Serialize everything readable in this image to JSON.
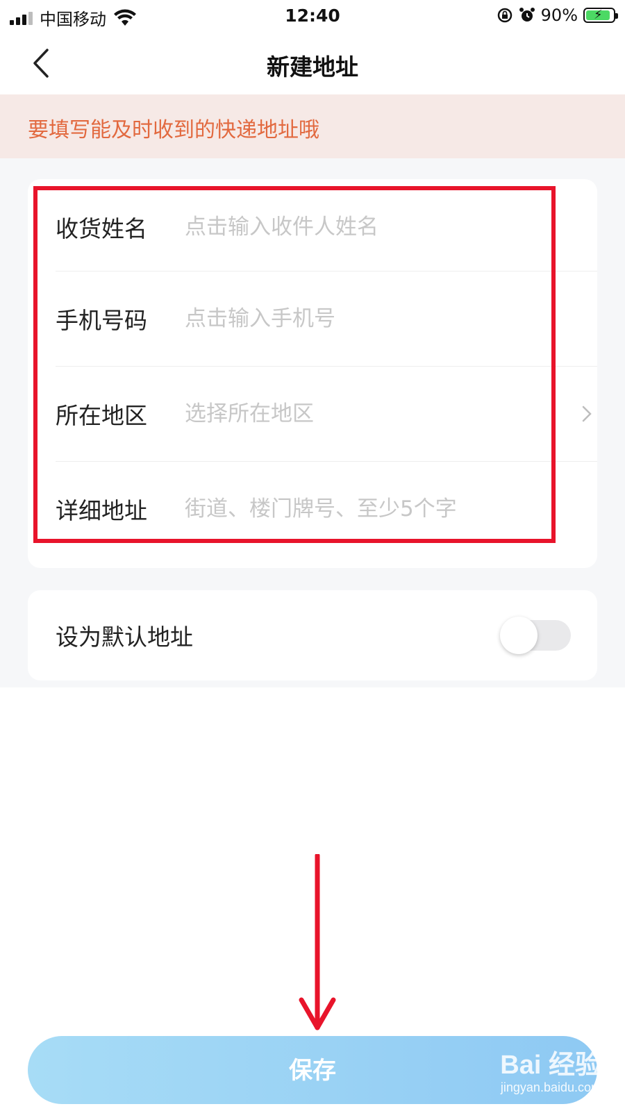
{
  "status_bar": {
    "carrier": "中国移动",
    "time": "12:40",
    "battery_percent": "90%",
    "battery_level": 0.9,
    "icons": [
      "signal-icon",
      "wifi-icon",
      "rotation-lock-icon",
      "alarm-icon",
      "battery-charging-icon"
    ]
  },
  "nav": {
    "title": "新建地址",
    "back_icon": "chevron-left-icon"
  },
  "notice": {
    "text": "要填写能及时收到的快递地址哦",
    "color": "#e2693f",
    "background": "#f6e9e6"
  },
  "form": {
    "fields": [
      {
        "label": "收货姓名",
        "value": "",
        "placeholder": "点击输入收件人姓名"
      },
      {
        "label": "手机号码",
        "value": "",
        "placeholder": "点击输入手机号"
      },
      {
        "label": "所在地区",
        "value": "",
        "placeholder": "选择所在地区",
        "icon": "chevron-right-icon"
      },
      {
        "label": "详细地址",
        "value": "",
        "placeholder": "街道、楼门牌号、至少5个字"
      }
    ]
  },
  "default_address": {
    "label": "设为默认地址",
    "enabled": false
  },
  "save_button": {
    "label": "保存"
  },
  "annotations": {
    "highlight_color": "#e8142b",
    "arrow_color": "#e8142b"
  },
  "watermark": {
    "logo": "Bai 经验",
    "url": "jingyan.baidu.com"
  },
  "colors": {
    "accent_gradient": [
      "#a7dcf6",
      "#8ec9f3"
    ],
    "placeholder": "#c7c7c7",
    "background_gray": "#f6f7f9"
  }
}
